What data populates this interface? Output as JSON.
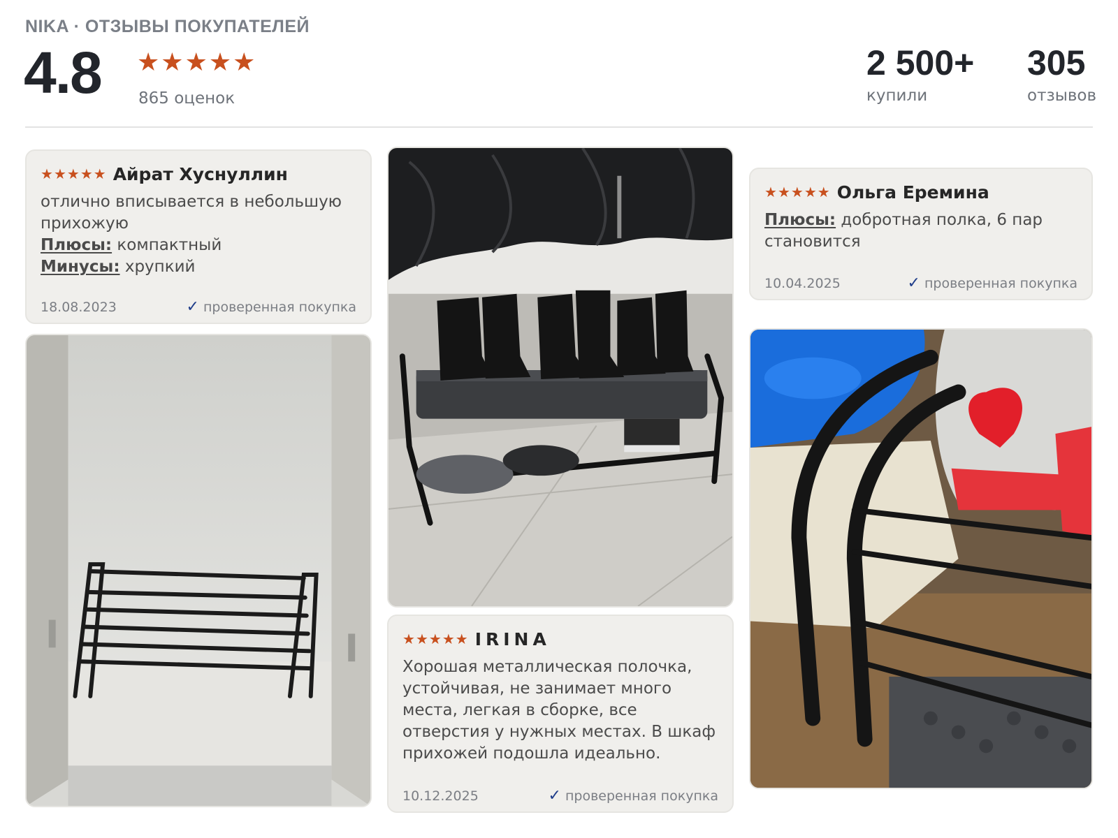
{
  "header": {
    "brand_title": "NIKA · ОТЗЫВЫ ПОКУПАТЕЛЕЙ",
    "rating": "4.8",
    "rating_stars": 5,
    "ratings_count": "865 оценок",
    "stats": {
      "bought_value": "2 500+",
      "bought_label": "купили",
      "reviews_value": "305",
      "reviews_label": "отзывов"
    }
  },
  "colors": {
    "star": "#c8501e",
    "check": "#1f3d8a",
    "card_bg": "#f0efec"
  },
  "icons": {
    "star": "star-icon",
    "verified": "checkmark-icon"
  },
  "reviews": [
    {
      "author": "Айрат Хуснуллин",
      "stars": 5,
      "text": "отлично вписывается в небольшую прихожую",
      "pros_label": "Плюсы:",
      "pros": "компактный",
      "cons_label": "Минусы:",
      "cons": "хрупкий",
      "date": "18.08.2023",
      "verified": "проверенная покупка"
    },
    {
      "author": "IRINA",
      "stars": 5,
      "text": "Хорошая металлическая полочка, устойчивая, не занимает много места, легкая в сборке, все отверстия у нужных местах. В шкаф прихожей подошла идеально.",
      "date": "10.12.2025",
      "verified": "проверенная покупка"
    },
    {
      "author": "Ольга Еремина",
      "stars": 5,
      "pros_label": "Плюсы:",
      "pros": "добротная полка, 6 пар становится",
      "date": "10.04.2025",
      "verified": "проверенная покупка"
    }
  ]
}
